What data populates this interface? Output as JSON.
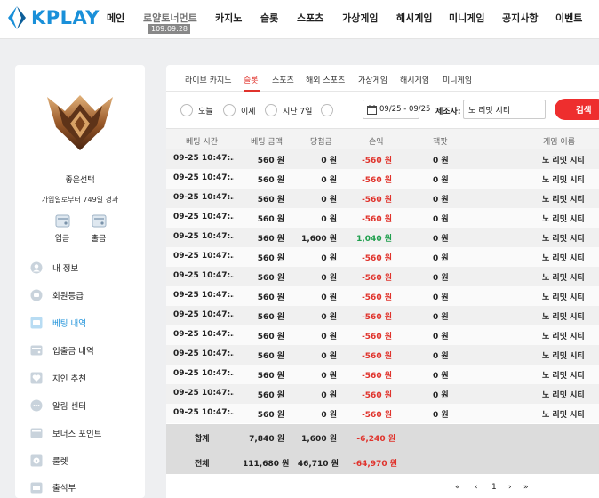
{
  "header": {
    "logo_text": "KPLAY",
    "nav": [
      {
        "label": "메인"
      },
      {
        "label": "로얄토너먼트",
        "sub": "109:09:28"
      },
      {
        "label": "카지노"
      },
      {
        "label": "슬롯"
      },
      {
        "label": "스포츠"
      },
      {
        "label": "가상게임"
      },
      {
        "label": "해시게임"
      },
      {
        "label": "미니게임"
      },
      {
        "label": "공지사항"
      },
      {
        "label": "이벤트"
      }
    ]
  },
  "sidebar": {
    "user_name": "좋은선택",
    "user_sub": "가입일로부터 749일 경과",
    "quick": [
      {
        "label": "입금",
        "icon": "deposit-icon"
      },
      {
        "label": "출금",
        "icon": "withdraw-icon"
      }
    ],
    "menu": [
      {
        "label": "내 정보",
        "icon": "user-info-icon"
      },
      {
        "label": "회원등급",
        "icon": "member-grade-icon"
      },
      {
        "label": "베팅 내역",
        "icon": "betting-history-icon"
      },
      {
        "label": "입출금 내역",
        "icon": "transaction-history-icon"
      },
      {
        "label": "지인 추천",
        "icon": "referral-icon"
      },
      {
        "label": "알림 센터",
        "icon": "notification-icon"
      },
      {
        "label": "보너스 포인트",
        "icon": "bonus-point-icon"
      },
      {
        "label": "룰렛",
        "icon": "roulette-icon"
      },
      {
        "label": "출석부",
        "icon": "attendance-icon"
      }
    ],
    "active_index": 2,
    "accent": "#1a90d9"
  },
  "main": {
    "tabs": [
      "라이브 카지노",
      "슬롯",
      "스포츠",
      "해외 스포츠",
      "가상게임",
      "해시게임",
      "미니게임"
    ],
    "active_tab": 1,
    "filters": {
      "radios": [
        "오늘",
        "이제",
        "지난 7일"
      ],
      "date_range": "09/25 - 09/25",
      "provider_label": "제조사:",
      "provider_value": "노 리밋 시티",
      "search_label": "검색"
    },
    "columns": [
      "베팅 시간",
      "베팅 금액",
      "당첨금",
      "손익",
      "잭팟",
      "게임 이름"
    ],
    "rows": [
      [
        "09-25 10:47:…",
        "560 원",
        "0 원",
        "-560 원",
        "0 원",
        "노 리밋 시티"
      ],
      [
        "09-25 10:47:…",
        "560 원",
        "0 원",
        "-560 원",
        "0 원",
        "노 리밋 시티"
      ],
      [
        "09-25 10:47:…",
        "560 원",
        "0 원",
        "-560 원",
        "0 원",
        "노 리밋 시티"
      ],
      [
        "09-25 10:47:…",
        "560 원",
        "0 원",
        "-560 원",
        "0 원",
        "노 리밋 시티"
      ],
      [
        "09-25 10:47:…",
        "560 원",
        "1,600 원",
        "1,040 원",
        "0 원",
        "노 리밋 시티"
      ],
      [
        "09-25 10:47:…",
        "560 원",
        "0 원",
        "-560 원",
        "0 원",
        "노 리밋 시티"
      ],
      [
        "09-25 10:47:…",
        "560 원",
        "0 원",
        "-560 원",
        "0 원",
        "노 리밋 시티"
      ],
      [
        "09-25 10:47:…",
        "560 원",
        "0 원",
        "-560 원",
        "0 원",
        "노 리밋 시티"
      ],
      [
        "09-25 10:47:…",
        "560 원",
        "0 원",
        "-560 원",
        "0 원",
        "노 리밋 시티"
      ],
      [
        "09-25 10:47:…",
        "560 원",
        "0 원",
        "-560 원",
        "0 원",
        "노 리밋 시티"
      ],
      [
        "09-25 10:47:…",
        "560 원",
        "0 원",
        "-560 원",
        "0 원",
        "노 리밋 시티"
      ],
      [
        "09-25 10:47:…",
        "560 원",
        "0 원",
        "-560 원",
        "0 원",
        "노 리밋 시티"
      ],
      [
        "09-25 10:47:…",
        "560 원",
        "0 원",
        "-560 원",
        "0 원",
        "노 리밋 시티"
      ],
      [
        "09-25 10:47:…",
        "560 원",
        "0 원",
        "-560 원",
        "0 원",
        "노 리밋 시티"
      ]
    ],
    "summary": [
      {
        "label": "합계",
        "bet": "7,840 원",
        "win": "1,600 원",
        "pl": "-6,240 원"
      },
      {
        "label": "전체",
        "bet": "111,680 원",
        "win": "46,710 원",
        "pl": "-64,970 원"
      }
    ],
    "pager": [
      "«",
      "‹",
      "1",
      "›",
      "»"
    ],
    "colors": {
      "negative": "#e0332c",
      "positive": "#1f9f4d",
      "search_button": "#ee2e2e"
    }
  }
}
